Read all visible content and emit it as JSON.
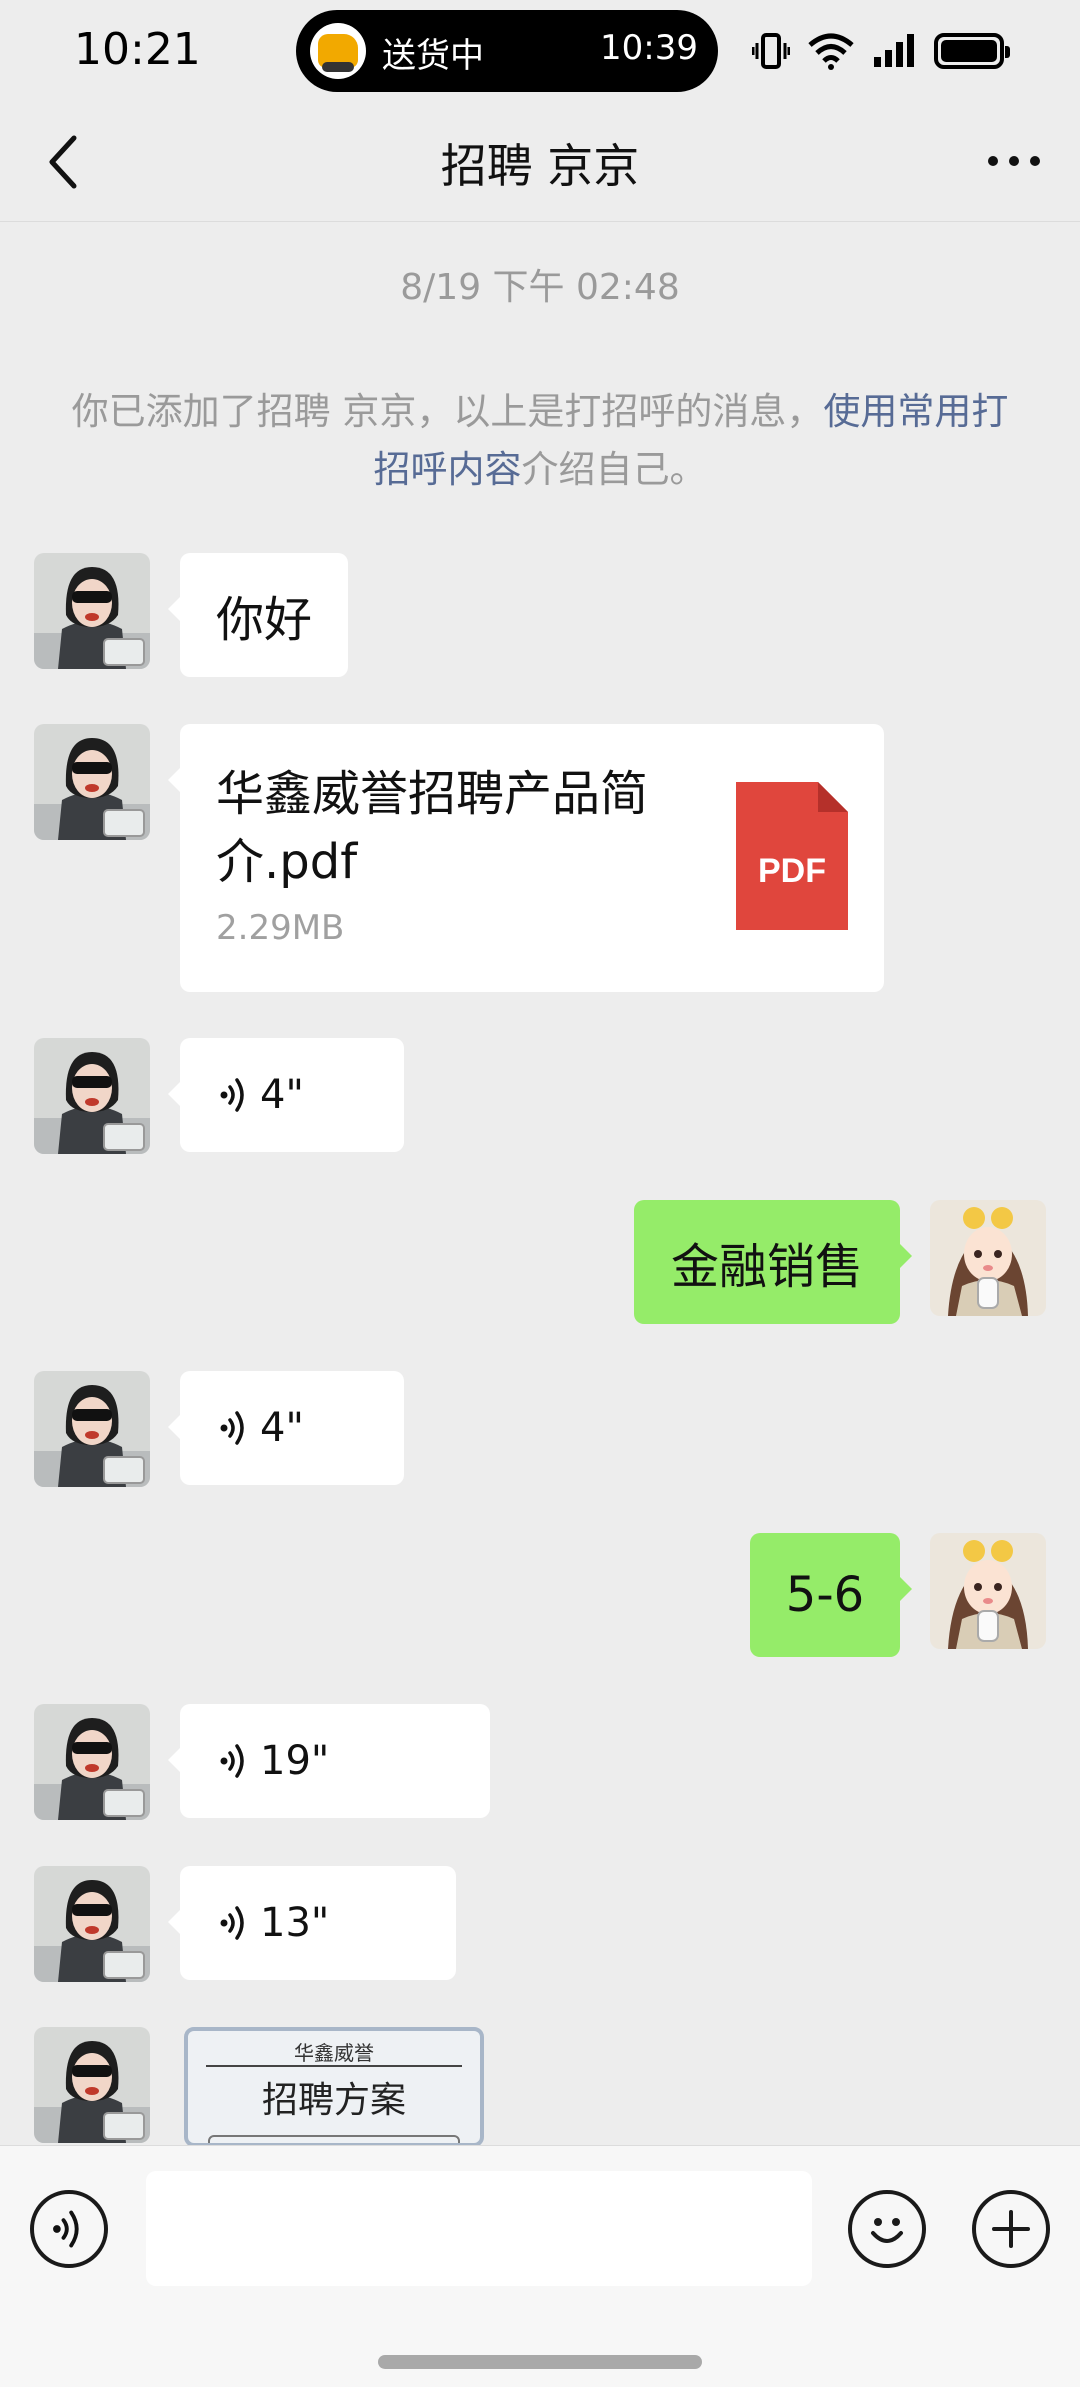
{
  "status_bar": {
    "time": "10:21",
    "activity_label": "送货中",
    "activity_time": "10:39"
  },
  "nav": {
    "title": "招聘 京京"
  },
  "chat": {
    "timestamp": "8/19 下午 02:48",
    "system_message": {
      "prefix": "你已添加了招聘 京京，以上是打招呼的消息，",
      "link": "使用常用打招呼内容",
      "suffix": "介绍自己。"
    },
    "messages": [
      {
        "side": "left",
        "type": "text",
        "text": "你好"
      },
      {
        "side": "left",
        "type": "file",
        "file_name": "华鑫威誉招聘产品简介.pdf",
        "file_size": "2.29MB",
        "file_badge": "PDF"
      },
      {
        "side": "left",
        "type": "voice",
        "duration": "4\""
      },
      {
        "side": "right",
        "type": "text",
        "text": "金融销售"
      },
      {
        "side": "left",
        "type": "voice",
        "duration": "4\""
      },
      {
        "side": "right",
        "type": "text",
        "text": "5-6"
      },
      {
        "side": "left",
        "type": "voice",
        "duration": "19\""
      },
      {
        "side": "left",
        "type": "voice",
        "duration": "13\""
      },
      {
        "side": "left",
        "type": "image",
        "image_brand": "华鑫威誉",
        "image_heading": "招聘方案"
      }
    ]
  },
  "colors": {
    "background": "#ededed",
    "outgoing_bubble": "#95ec69",
    "incoming_bubble": "#ffffff",
    "link": "#576b95",
    "pdf_red": "#e0463d"
  },
  "icons": [
    "back-arrow-icon",
    "more-dots-icon",
    "voice-wave-icon",
    "pdf-icon",
    "voice-input-icon",
    "emoji-icon",
    "plus-icon"
  ]
}
